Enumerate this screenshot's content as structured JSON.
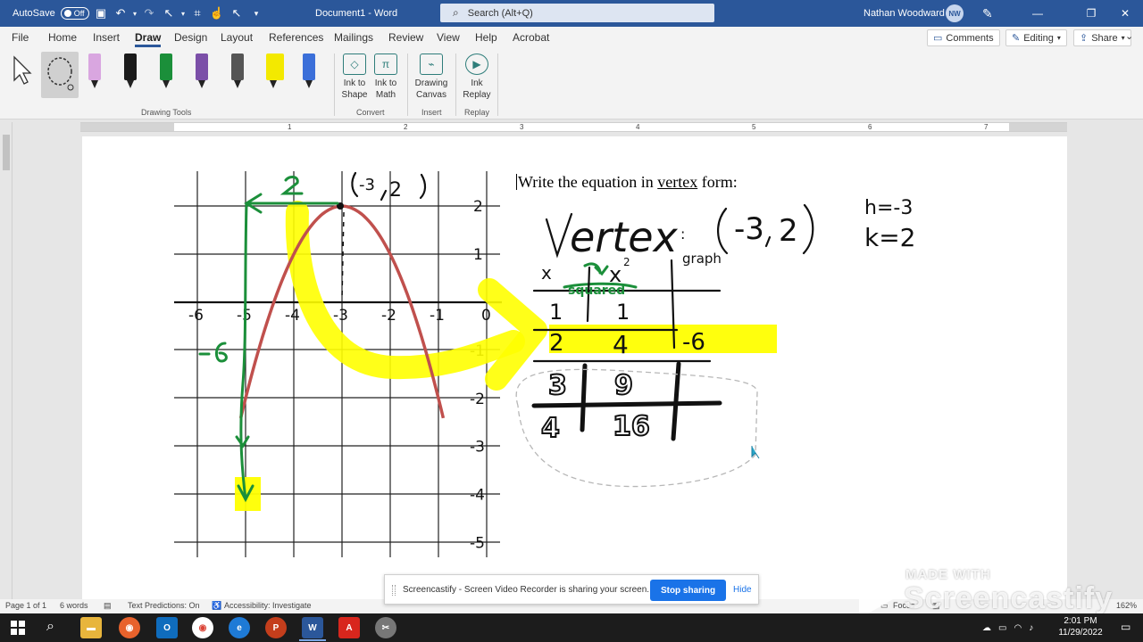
{
  "titlebar": {
    "autosave_label": "AutoSave",
    "autosave_state": "Off",
    "doc_title": "Document1  -  Word",
    "search_placeholder": "Search (Alt+Q)",
    "user_name": "Nathan Woodward",
    "user_initials": "NW"
  },
  "ribbon": {
    "tabs": [
      "File",
      "Home",
      "Insert",
      "Draw",
      "Design",
      "Layout",
      "References",
      "Mailings",
      "Review",
      "View",
      "Help",
      "Acrobat"
    ],
    "active_tab": "Draw",
    "comments_label": "Comments",
    "editing_label": "Editing",
    "share_label": "Share",
    "groups": {
      "drawing_tools": "Drawing Tools",
      "convert": "Convert",
      "insert": "Insert",
      "replay": "Replay"
    },
    "buttons": {
      "ink_to_shape_1": "Ink to",
      "ink_to_shape_2": "Shape",
      "ink_to_math_1": "Ink to",
      "ink_to_math_2": "Math",
      "drawing_canvas_1": "Drawing",
      "drawing_canvas_2": "Canvas",
      "ink_replay_1": "Ink",
      "ink_replay_2": "Replay"
    },
    "pen_colors": [
      "#d9a6e0",
      "#1a1a1a",
      "#1b8f3a",
      "#7b4fa8",
      "#555555",
      "#f3e900",
      "#3b6fd9"
    ]
  },
  "ruler": {
    "numbers": [
      "1",
      "1",
      "2",
      "3",
      "4",
      "5",
      "6",
      "7"
    ]
  },
  "document": {
    "text_before": "Write the equation in ",
    "text_underlined": "vertex",
    "text_after": " form:"
  },
  "graph": {
    "x_ticks": [
      "-6",
      "-5",
      "-4",
      "-3",
      "-2",
      "-1",
      "0"
    ],
    "y_ticks": [
      "2",
      "1",
      "-1",
      "-2",
      "-3",
      "-4",
      "-5"
    ],
    "curve_color": "#c0504d",
    "highlight_color": "#ffff00",
    "ink_green": "#1b8f3a"
  },
  "statusbar": {
    "page": "Page 1 of 1",
    "words": "6 words",
    "predictions": "Text Predictions: On",
    "accessibility": "Accessibility: Investigate",
    "focus": "Focus",
    "zoom": "162%"
  },
  "share_notice": {
    "message": "Screencastify - Screen Video Recorder is sharing your screen.",
    "stop_label": "Stop sharing",
    "hide_label": "Hide"
  },
  "watermark": {
    "made_with": "MADE WITH",
    "brand": "Screencastify"
  },
  "taskbar": {
    "time": "2:01 PM",
    "date": "11/29/2022"
  }
}
